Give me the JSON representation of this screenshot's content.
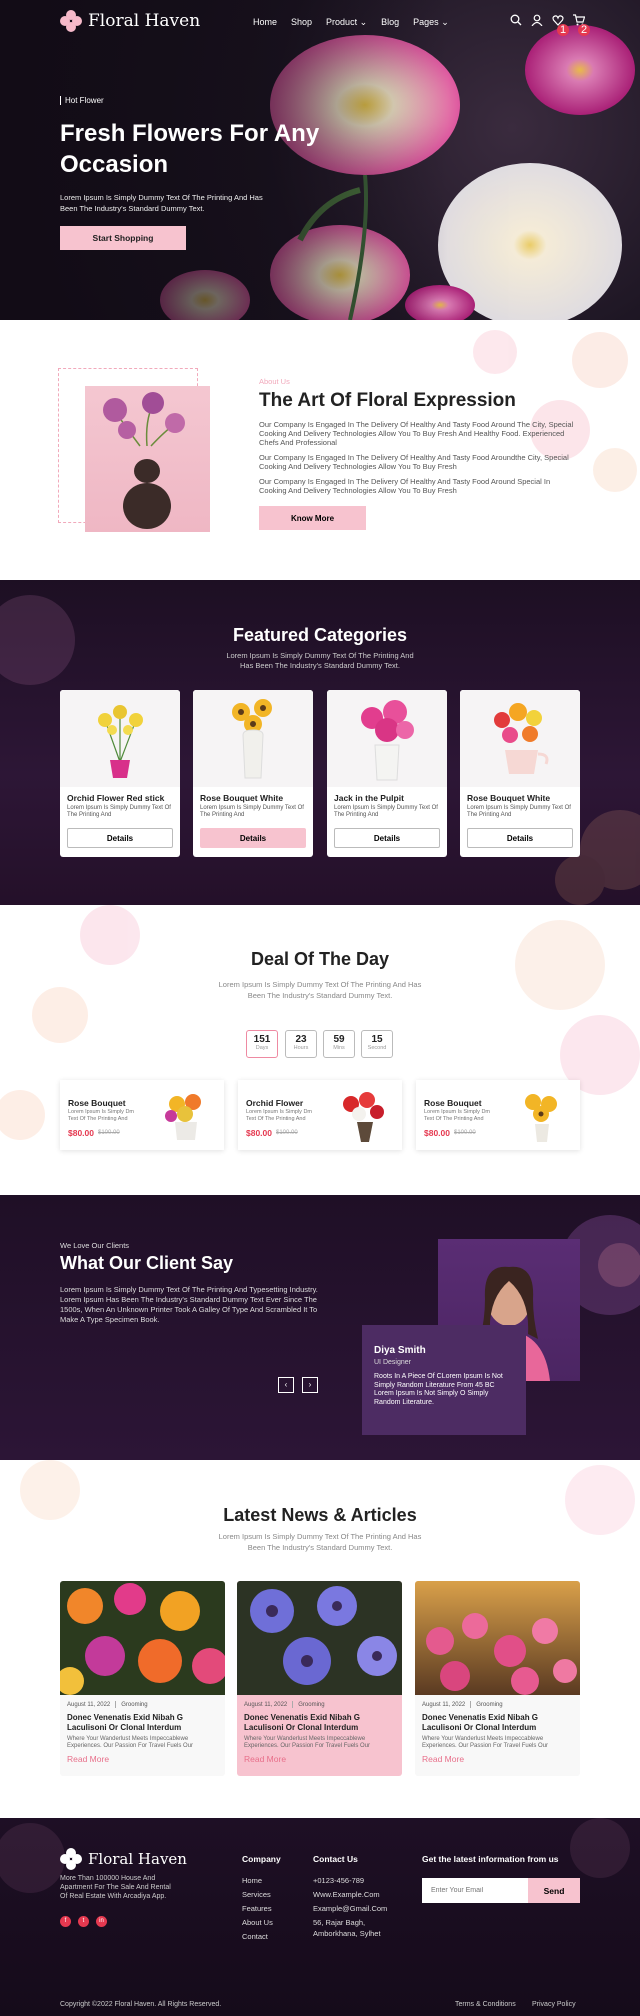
{
  "brand": {
    "name": "Floral Haven",
    "accent": "#f7c3cf",
    "dark": "#1d0f23",
    "badge_color": "#e53950"
  },
  "nav": {
    "items": [
      "Home",
      "Shop",
      "Product",
      "Blog",
      "Pages"
    ]
  },
  "header_icons": {
    "search": "search-icon",
    "user": "user-icon",
    "wishlist": "heart-icon",
    "cart": "cart-icon",
    "wishlist_count": "1",
    "cart_count": "2"
  },
  "hero": {
    "tag": "Hot Flower",
    "title": "Fresh Flowers For Any Occasion",
    "subtitle": "Lorem Ipsum Is Simply Dummy Text Of The Printing And Has Been The Industry's Standard Dummy Text.",
    "button": "Start Shopping"
  },
  "about": {
    "kicker": "About Us",
    "title": "The Art Of Floral Expression",
    "p1": "Our Company Is Engaged In The Delivery Of Healthy And Tasty Food Around The City, Special Cooking And Delivery Technologies Allow You To Buy Fresh And Healthy Food. Experienced Chefs And Professional",
    "p2": "Our Company Is Engaged In The Delivery Of Healthy And Tasty Food Aroundthe City, Special Cooking And Delivery Technologies Allow You To Buy Fresh",
    "p3": "Our Company Is Engaged In The Delivery Of Healthy And Tasty Food Around  Special In Cooking And Delivery Technologies Allow You To Buy Fresh",
    "button": "Know More"
  },
  "featured": {
    "title": "Featured Categories",
    "subtitle": "Lorem Ipsum Is Simply Dummy Text Of The Printing And Has Been The Industry's Standard Dummy Text.",
    "cards": [
      {
        "name": "Orchid Flower Red stick",
        "desc": "Lorem Ipsum Is Simply Dummy Text Of The Printing And",
        "button": "Details"
      },
      {
        "name": "Rose Bouquet White",
        "desc": "Lorem Ipsum Is Simply Dummy Text Of The Printing And",
        "button": "Details"
      },
      {
        "name": "Jack in the Pulpit",
        "desc": "Lorem Ipsum Is Simply Dummy Text Of The Printing And",
        "button": "Details"
      },
      {
        "name": "Rose Bouquet White",
        "desc": "Lorem Ipsum Is Simply Dummy Text Of The Printing And",
        "button": "Details"
      }
    ]
  },
  "deal": {
    "title": "Deal Of The Day",
    "subtitle": "Lorem Ipsum Is Simply Dummy Text Of The Printing And Has Been The Industry's Standard Dummy Text.",
    "timer": [
      {
        "value": "151",
        "label": "Days"
      },
      {
        "value": "23",
        "label": "Hours"
      },
      {
        "value": "59",
        "label": "Mins"
      },
      {
        "value": "15",
        "label": "Second"
      }
    ],
    "cards": [
      {
        "name": "Rose Bouquet",
        "desc": "Lorem Ipsum Is Simply Dm Text Of The Printing And",
        "price": "$80.00",
        "old_price": "$100.00"
      },
      {
        "name": "Orchid Flower",
        "desc": "Lorem Ipsum Is Simply Dm Text Of The Printing And",
        "price": "$80.00",
        "old_price": "$100.00"
      },
      {
        "name": "Rose Bouquet",
        "desc": "Lorem Ipsum Is Simply Dm Text Of The Printing And",
        "price": "$80.00",
        "old_price": "$100.00"
      }
    ]
  },
  "testimonial": {
    "kicker": "We Love Our Clients",
    "title": "What Our Client Say",
    "text": "Lorem Ipsum Is Simply Dummy Text Of The Printing And Typesetting Industry. Lorem Ipsum Has Been The Industry's Standard Dummy Text Ever Since The 1500s, When An Unknown Printer Took A Galley Of Type And Scrambled It To Make A Type Specimen Book.",
    "name": "Diya Smith",
    "role": "UI Designer",
    "quote": "Roots In A Piece Of CLorem Ipsum Is Not Simply Random  Literature From 45 BC Lorem Ipsum Is Not Simply O Simply Random  Literature.",
    "prev": "‹",
    "next": "›"
  },
  "news": {
    "title": "Latest News & Articles",
    "subtitle": "Lorem Ipsum Is Simply Dummy Text Of The Printing And Has Been The Industry's Standard Dummy Text.",
    "cards": [
      {
        "date": "August 11, 2022",
        "category": "Grooming",
        "headline": "Donec Venenatis Exid Nibah G Laculisoni Or Clonal Interdum",
        "desc": "Where Your Wanderlust Meets Impeccablewe Experiences. Our Passion For Travel Fuels Our",
        "more": "Read More"
      },
      {
        "date": "August 11, 2022",
        "category": "Grooming",
        "headline": "Donec Venenatis Exid Nibah G Laculisoni Or Clonal Interdum",
        "desc": "Where Your Wanderlust Meets Impeccablewe Experiences. Our Passion For Travel Fuels Our",
        "more": "Read More"
      },
      {
        "date": "August 11, 2022",
        "category": "Grooming",
        "headline": "Donec Venenatis Exid Nibah G Laculisoni Or Clonal Interdum",
        "desc": "Where Your Wanderlust Meets Impeccablewe Experiences. Our Passion For Travel Fuels Our",
        "more": "Read More"
      }
    ]
  },
  "footer": {
    "brand": "Floral Haven",
    "desc": "More Than 100000 House And Apartment For The Sale And Rental Of Real Estate With Arcadiya App.",
    "social": [
      "f",
      "t",
      "in"
    ],
    "company_heading": "Company",
    "company_links": [
      "Home",
      "Services",
      "Features",
      "About Us",
      "Contact"
    ],
    "contact_heading": "Contact Us",
    "contact": [
      "+0123-456-789",
      "Www.Example.Com",
      "Example@Gmail.Com",
      "56, Rajar Bagh,",
      "Amborkhana, Sylhet"
    ],
    "newsletter_heading": "Get the latest information from us",
    "email_placeholder": "Enter Your Email",
    "send": "Send",
    "copyright": "Copyright ©2022 Floral Haven. All Rights Reserved.",
    "terms": "Terms & Conditions",
    "privacy": "Privacy Policy"
  }
}
